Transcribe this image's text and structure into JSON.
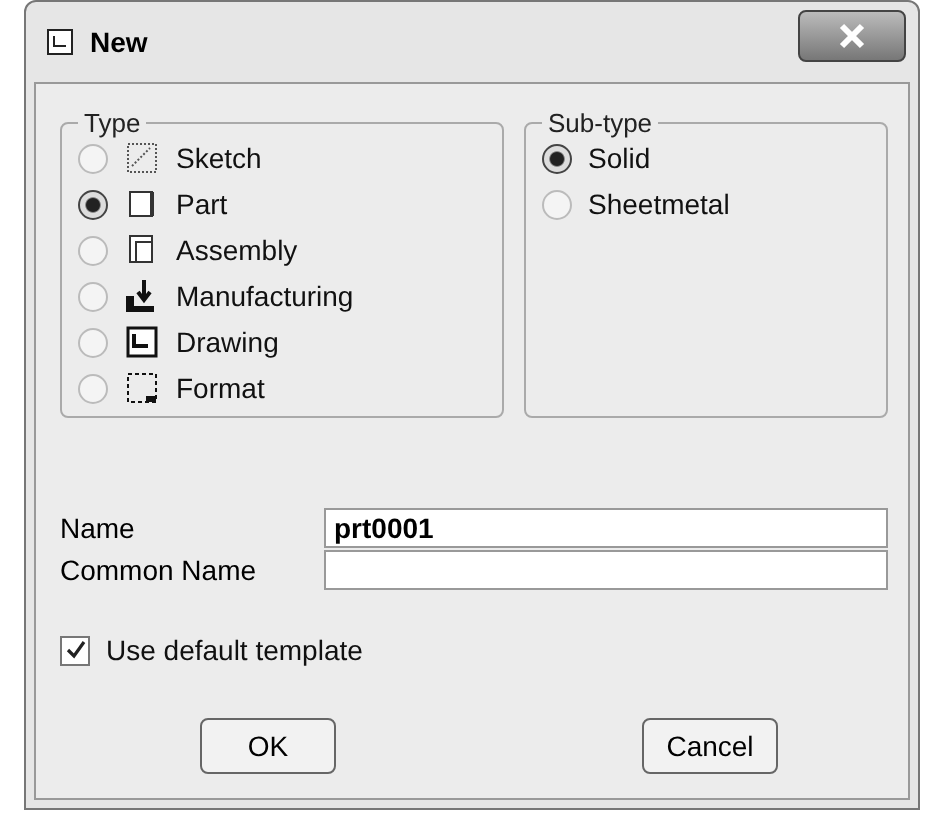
{
  "window": {
    "title": "New"
  },
  "type_group": {
    "title": "Type",
    "items": [
      {
        "label": "Sketch",
        "kind": "sketch",
        "selected": false
      },
      {
        "label": "Part",
        "kind": "part",
        "selected": true
      },
      {
        "label": "Assembly",
        "kind": "assembly",
        "selected": false
      },
      {
        "label": "Manufacturing",
        "kind": "manufacturing",
        "selected": false
      },
      {
        "label": "Drawing",
        "kind": "drawing",
        "selected": false
      },
      {
        "label": "Format",
        "kind": "format",
        "selected": false
      }
    ]
  },
  "subtype_group": {
    "title": "Sub-type",
    "items": [
      {
        "label": "Solid",
        "selected": true
      },
      {
        "label": "Sheetmetal",
        "selected": false
      }
    ]
  },
  "fields": [
    {
      "label": "Name",
      "value": "prt0001"
    },
    {
      "label": "Common Name"
    }
  ],
  "use_default_template": {
    "label": "Use default template",
    "checked": true
  },
  "buttons": [
    "OK",
    "Cancel"
  ]
}
